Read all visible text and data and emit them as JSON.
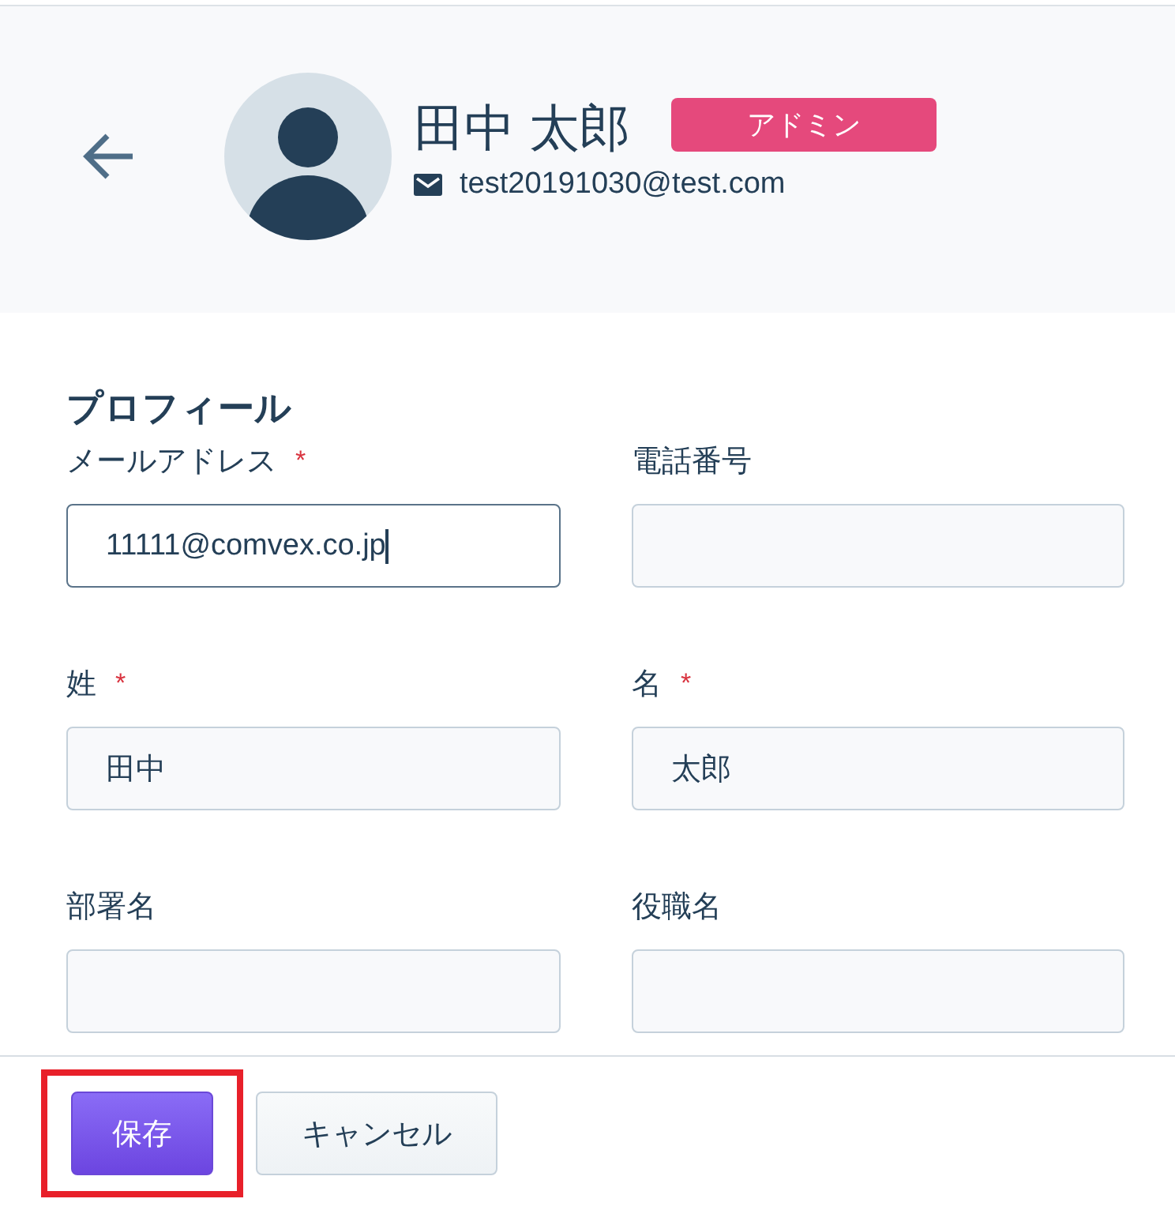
{
  "header": {
    "name": "田中 太郎",
    "role_badge": "アドミン",
    "email": "test20191030@test.com"
  },
  "profile": {
    "title": "プロフィール",
    "fields": [
      {
        "label": "メールアドレス",
        "required_mark": "*",
        "value": "11111@comvex.co.jp",
        "focused": true
      },
      {
        "label": "電話番号",
        "focused": false
      },
      {
        "label": "姓",
        "required_mark": "*",
        "value": "田中",
        "focused": false
      },
      {
        "label": "名",
        "required_mark": "*",
        "value": "太郎",
        "focused": false
      },
      {
        "label": "部署名",
        "focused": false
      },
      {
        "label": "役職名",
        "focused": false
      }
    ]
  },
  "buttons": [
    {
      "label": "保存",
      "kind": "primary",
      "highlighted": true
    },
    {
      "label": "キャンセル",
      "kind": "secondary",
      "highlighted": false
    }
  ]
}
